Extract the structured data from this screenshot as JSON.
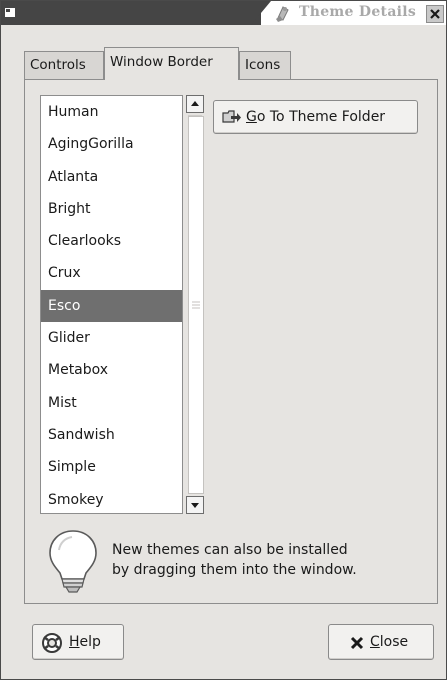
{
  "window": {
    "title": "Theme Details",
    "menu_icon": "window-menu-icon",
    "window_icon": "theme-details-icon",
    "close_icon": "close-x-icon"
  },
  "tabs": [
    {
      "label": "Controls",
      "active": false
    },
    {
      "label": "Window Border",
      "active": true
    },
    {
      "label": "Icons",
      "active": false
    }
  ],
  "theme_list": {
    "items": [
      "Human",
      "AgingGorilla",
      "Atlanta",
      "Bright",
      "Clearlooks",
      "Crux",
      "Esco",
      "Glider",
      "Metabox",
      "Mist",
      "Sandwish",
      "Simple",
      "Smokey"
    ],
    "selected": "Esco",
    "selected_color": "#6f6f6f"
  },
  "goto_button": {
    "mnemonic": "G",
    "label_rest": "o To Theme Folder",
    "icon": "folder-go-icon"
  },
  "info": {
    "icon": "lightbulb-icon",
    "line1": "New themes can also be installed",
    "line2": "by dragging them into the window."
  },
  "footer": {
    "help": {
      "mnemonic": "H",
      "label_rest": "elp",
      "icon": "help-lifebuoy-icon"
    },
    "close": {
      "mnemonic": "C",
      "label_rest": "lose",
      "icon": "close-x-icon"
    }
  }
}
